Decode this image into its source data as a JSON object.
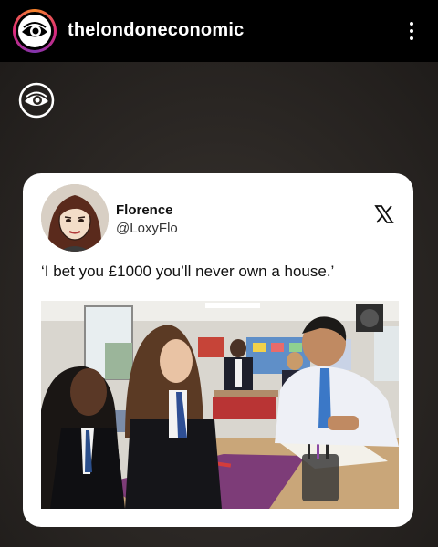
{
  "header": {
    "username": "thelondoneconomic",
    "avatar_icon": "eye-logo-icon",
    "more_icon": "more-vertical-icon"
  },
  "watermark_icon": "eye-logo-icon",
  "tweet": {
    "display_name": "Florence",
    "handle": "@LoxyFlo",
    "text": "‘I bet you £1000 you’ll never own a house.’",
    "platform_icon": "x-logo-icon",
    "image_description_icon": "classroom-photo"
  },
  "colors": {
    "topbar": "#000000",
    "background": "#2a2622",
    "card": "#ffffff",
    "ring_start": "#f58529",
    "ring_end": "#8134af"
  }
}
